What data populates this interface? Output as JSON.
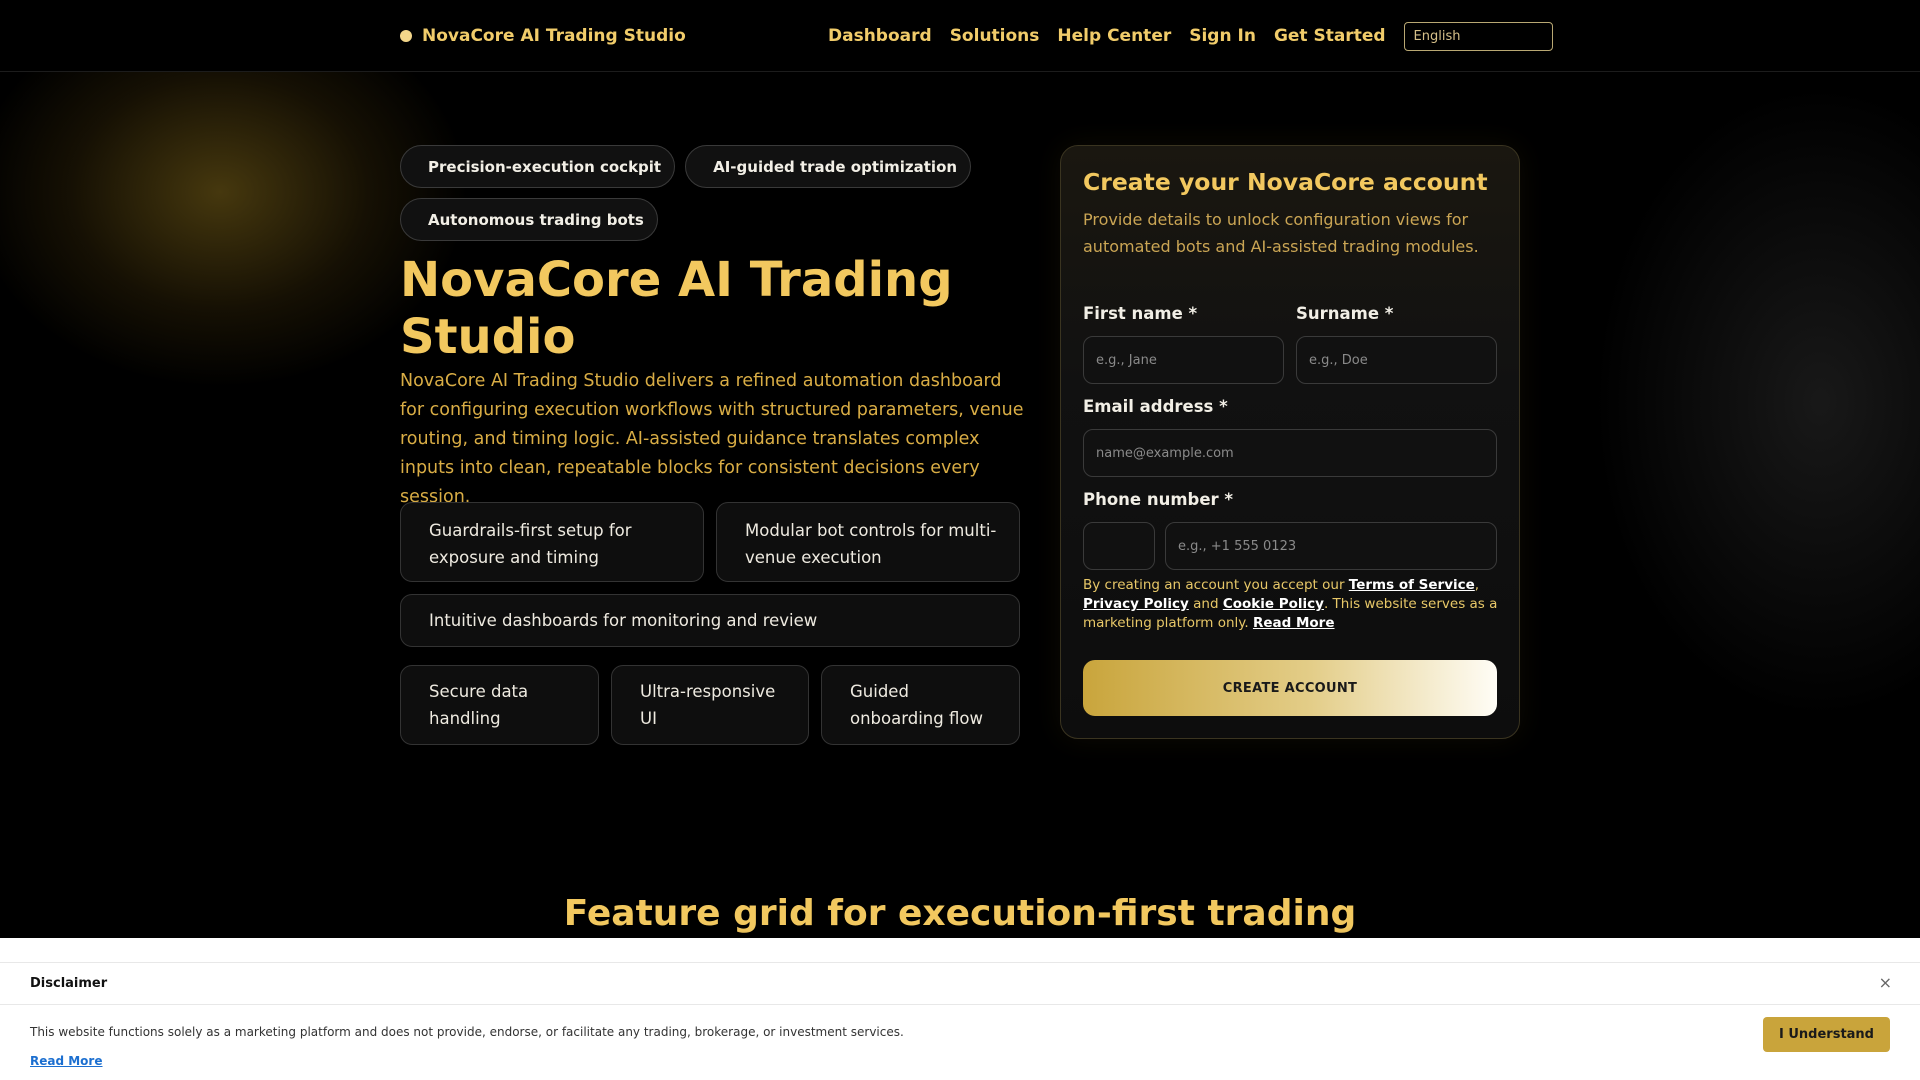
{
  "header": {
    "brand": "NovaCore AI Trading Studio",
    "nav": [
      "Dashboard",
      "Solutions",
      "Help Center",
      "Sign In",
      "Get Started"
    ],
    "language": "English"
  },
  "hero": {
    "pills": [
      "Precision-execution cockpit",
      "AI-guided trade optimization",
      "Autonomous trading bots"
    ],
    "title": "NovaCore AI Trading Studio",
    "description": "NovaCore AI Trading Studio delivers a refined automation dashboard for configuring execution workflows with structured parameters, venue routing, and timing logic. AI-assisted guidance translates complex inputs into clean, repeatable blocks for consistent decisions every session.",
    "features": [
      "Guardrails-first setup for exposure and timing",
      "Modular bot controls for multi-venue execution",
      "Intuitive dashboards for monitoring and review"
    ],
    "mini_features": [
      "Secure data handling",
      "Ultra-responsive UI",
      "Guided onboarding flow"
    ]
  },
  "form": {
    "title": "Create your NovaCore account",
    "subtitle": "Provide details to unlock configuration views for automated bots and AI-assisted trading modules.",
    "first_name_label": "First name *",
    "first_name_placeholder": "e.g., Jane",
    "surname_label": "Surname *",
    "surname_placeholder": "e.g., Doe",
    "email_label": "Email address *",
    "email_placeholder": "name@example.com",
    "phone_label": "Phone number *",
    "phone_placeholder": "e.g., +1 555 0123",
    "legal_prefix": "By creating an account you accept our ",
    "terms": "Terms of Service",
    "comma": ",",
    "privacy": "Privacy Policy",
    "and": " and ",
    "cookie": "Cookie Policy",
    "legal_suffix": ". This website serves as a marketing platform only. ",
    "read_more": "Read More",
    "submit": "CREATE ACCOUNT"
  },
  "section": {
    "title": "Feature grid for execution-first trading"
  },
  "disclaimer": {
    "title": "Disclaimer",
    "close": "×",
    "text": "This website functions solely as a marketing platform and does not provide, endorse, or facilitate any trading, brokerage, or investment services.",
    "read_more": "Read More",
    "button": "I Understand"
  },
  "icons": {
    "pill": "",
    "card": ""
  }
}
